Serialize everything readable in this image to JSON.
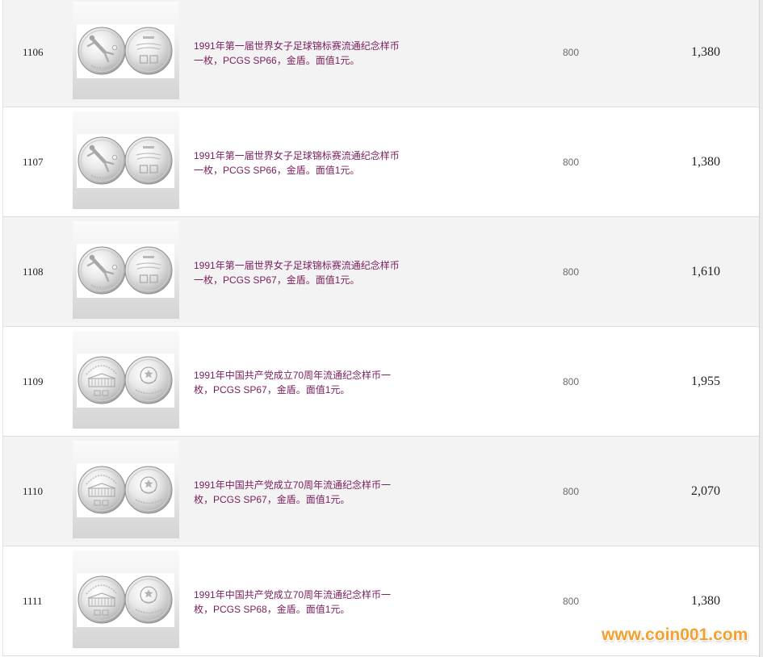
{
  "lots": [
    {
      "lot": "1106",
      "description": [
        "1991年第一届世界女子足球锦标赛流通纪念样币",
        "一枚，PCGS SP66，金盾。面值1元。"
      ],
      "estimate": "800",
      "price": "1,380"
    },
    {
      "lot": "1107",
      "description": [
        "1991年第一届世界女子足球锦标赛流通纪念样币",
        "一枚，PCGS SP66，金盾。面值1元。"
      ],
      "estimate": "800",
      "price": "1,380"
    },
    {
      "lot": "1108",
      "description": [
        "1991年第一届世界女子足球锦标赛流通纪念样币",
        "一枚，PCGS SP67，金盾。面值1元。"
      ],
      "estimate": "800",
      "price": "1,610"
    },
    {
      "lot": "1109",
      "description": [
        "1991年中国共产党成立70周年流通纪念样币一",
        "枚，PCGS SP67，金盾。面值1元。"
      ],
      "estimate": "800",
      "price": "1,955"
    },
    {
      "lot": "1110",
      "description": [
        "1991年中国共产党成立70周年流通纪念样币一",
        "枚，PCGS SP67，金盾。面值1元。"
      ],
      "estimate": "800",
      "price": "2,070"
    },
    {
      "lot": "1111",
      "description": [
        "1991年中国共产党成立70周年流通纪念样币一",
        "枚，PCGS SP68，金盾。面值1元。"
      ],
      "estimate": "800",
      "price": "1,380"
    }
  ],
  "watermark": "www.coin001.com",
  "colors": {
    "description_text": "#7a1e5b",
    "row_alt_background": "#f3f3f3",
    "watermark": "#f3a02e"
  }
}
